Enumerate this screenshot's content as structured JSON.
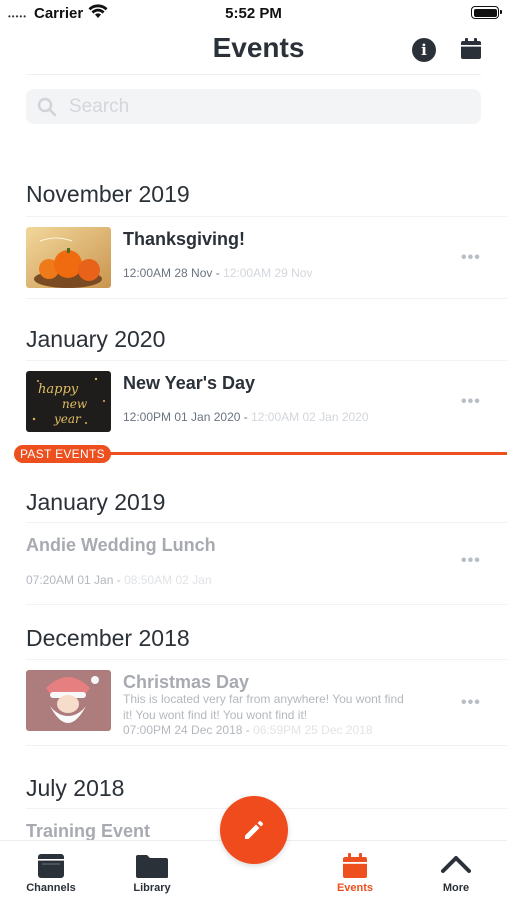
{
  "status_bar": {
    "dots": "•••••",
    "carrier": "Carrier",
    "time": "5:52 PM"
  },
  "header": {
    "title": "Events",
    "info_icon": "info-icon",
    "calendar_icon": "calendar-icon"
  },
  "search": {
    "placeholder": "Search"
  },
  "upcoming": [
    {
      "month": "November 2019",
      "events": [
        {
          "title": "Thanksgiving!",
          "start": "12:00AM 28 Nov",
          "end": "12:00AM 29 Nov",
          "image": "thanksgiving-pumpkins"
        }
      ]
    },
    {
      "month": "January 2020",
      "events": [
        {
          "title": "New Year's Day",
          "start": "12:00PM 01 Jan 2020",
          "end": "12:00AM 02 Jan 2020",
          "image": "happy-new-year"
        }
      ]
    }
  ],
  "past_label": "PAST EVENTS",
  "past": [
    {
      "month": "January 2019",
      "events": [
        {
          "title": "Andie Wedding Lunch",
          "start": "07:20AM 01 Jan",
          "end": "08:50AM 02 Jan"
        }
      ]
    },
    {
      "month": "December 2018",
      "events": [
        {
          "title": "Christmas Day",
          "description_line1": "This is located very far from anywhere! You wont find",
          "description_line2": "it! You wont find it! You wont find it!",
          "start": "07:00PM 24 Dec 2018",
          "end": "06:59PM 25 Dec 2018",
          "image": "santa-claus"
        }
      ]
    },
    {
      "month": "July 2018",
      "events": [
        {
          "title": "Training Event"
        }
      ]
    }
  ],
  "date_separator": "-",
  "more_glyph": "•••",
  "fab": {
    "icon": "pencil-icon"
  },
  "tabs": [
    {
      "label": "Channels",
      "icon": "channels-icon",
      "active": false
    },
    {
      "label": "Library",
      "icon": "folder-icon",
      "active": false
    },
    {
      "label": "Events",
      "icon": "calendar-icon",
      "active": true
    },
    {
      "label": "More",
      "icon": "chevron-up-icon",
      "active": false
    }
  ],
  "colors": {
    "accent": "#ee4f1f",
    "text": "#2b3138",
    "muted": "#a7abb1"
  }
}
